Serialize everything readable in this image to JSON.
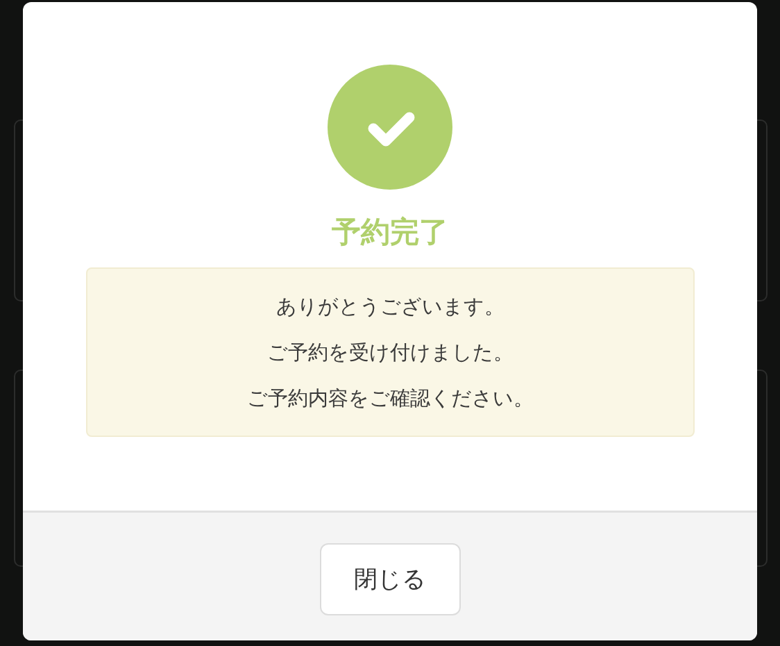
{
  "dialog": {
    "title": "予約完了",
    "message_lines": [
      "ありがとうございます。",
      "ご予約を受け付けました。",
      "ご予約内容をご確認ください。"
    ],
    "buttons": [
      "閉じる"
    ]
  }
}
